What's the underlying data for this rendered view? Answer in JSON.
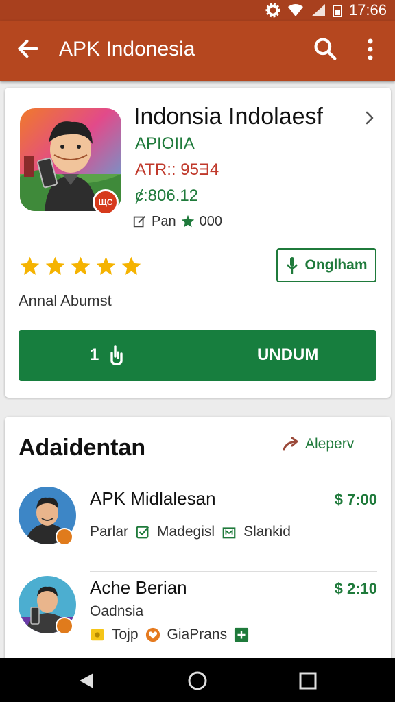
{
  "status_bar": {
    "time": "17:66"
  },
  "app_bar": {
    "title": "APK Indonesia"
  },
  "app": {
    "name": "Indonsia Indolaesf",
    "developer": "APIOIIA",
    "version": "ATR:: 95Ǝ4",
    "price": "ȼ:806.12",
    "meta_label": "Pan",
    "meta_rating": "000",
    "icon_badge": "ЩC",
    "rating_label": "Annal Abumst",
    "outline_button_label": "Onglham",
    "install_count": "1",
    "install_label": "UNDUM",
    "rating_stars": 5
  },
  "section": {
    "title": "Adaidentan",
    "link_label": "Aleperv"
  },
  "list": [
    {
      "title": "APK Midlalesan",
      "price": "$ 7:00",
      "tags": [
        "Parlar",
        "Madegisl",
        "Slankid"
      ]
    },
    {
      "title": "Ache Berian",
      "subtitle": "Oadnsia",
      "price": "$ 2:10",
      "tags": [
        "Tojp",
        "GiaPrans"
      ]
    }
  ],
  "colors": {
    "app_bar": "#b5471f",
    "accent_green": "#177e3e",
    "star": "#f5b301"
  },
  "icons": [
    "back-arrow-icon",
    "search-icon",
    "more-vert-icon",
    "chevron-right-icon",
    "edit-icon",
    "star-icon",
    "mic-icon",
    "touch-icon",
    "arrow-icon",
    "back-nav-icon",
    "home-nav-icon",
    "recents-nav-icon"
  ]
}
